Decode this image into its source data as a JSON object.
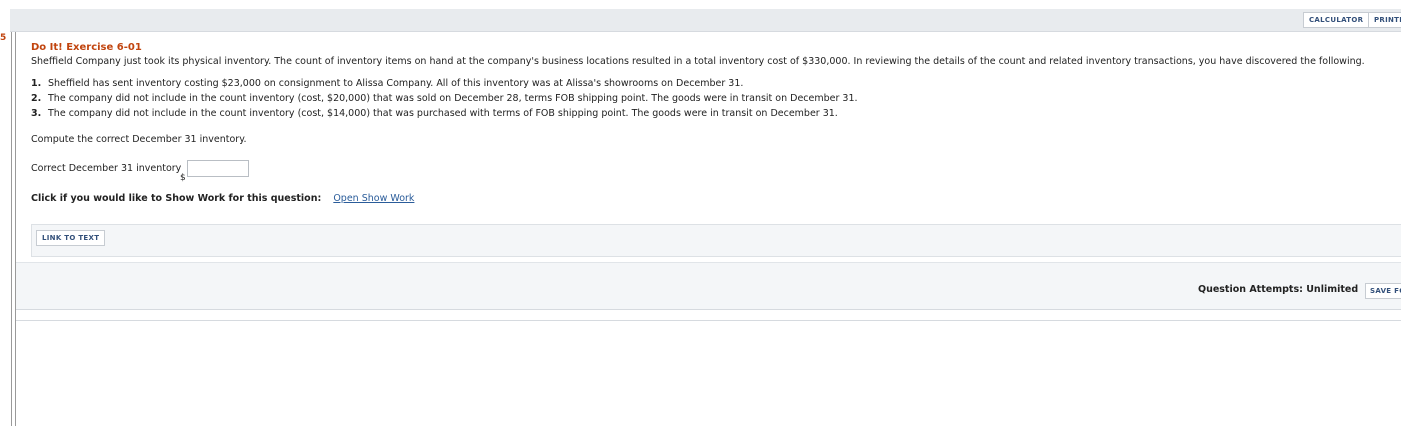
{
  "toolbar": {
    "calculator_label": "CALCULATOR",
    "printer_label": "PRINTE"
  },
  "left_marker": "5",
  "question": {
    "title": "Do It! Exercise 6-01",
    "intro": "Sheffield Company just took its physical inventory. The count of inventory items on hand at the company's business locations resulted in a total inventory cost of $330,000. In reviewing the details of the count and related inventory transactions, you have discovered the following.",
    "items": [
      {
        "num": "1.",
        "text": "Sheffield has sent inventory costing $23,000 on consignment to Alissa Company. All of this inventory was at Alissa's showrooms on December 31."
      },
      {
        "num": "2.",
        "text": "The company did not include in the count inventory (cost, $20,000) that was sold on December 28, terms FOB shipping point. The goods were in transit on December 31."
      },
      {
        "num": "3.",
        "text": "The company did not include in the count inventory (cost, $14,000) that was purchased with terms of FOB shipping point. The goods were in transit on December 31."
      }
    ],
    "prompt": "Compute the correct December 31 inventory.",
    "answer_label": "Correct December 31 inventory",
    "currency": "$",
    "answer_value": ""
  },
  "show_work": {
    "label": "Click if you would like to Show Work for this question:",
    "link": "Open Show Work"
  },
  "link_to_text_label": "LINK TO TEXT",
  "footer": {
    "attempts": "Question Attempts: Unlimited",
    "save_label": "SAVE FO"
  }
}
